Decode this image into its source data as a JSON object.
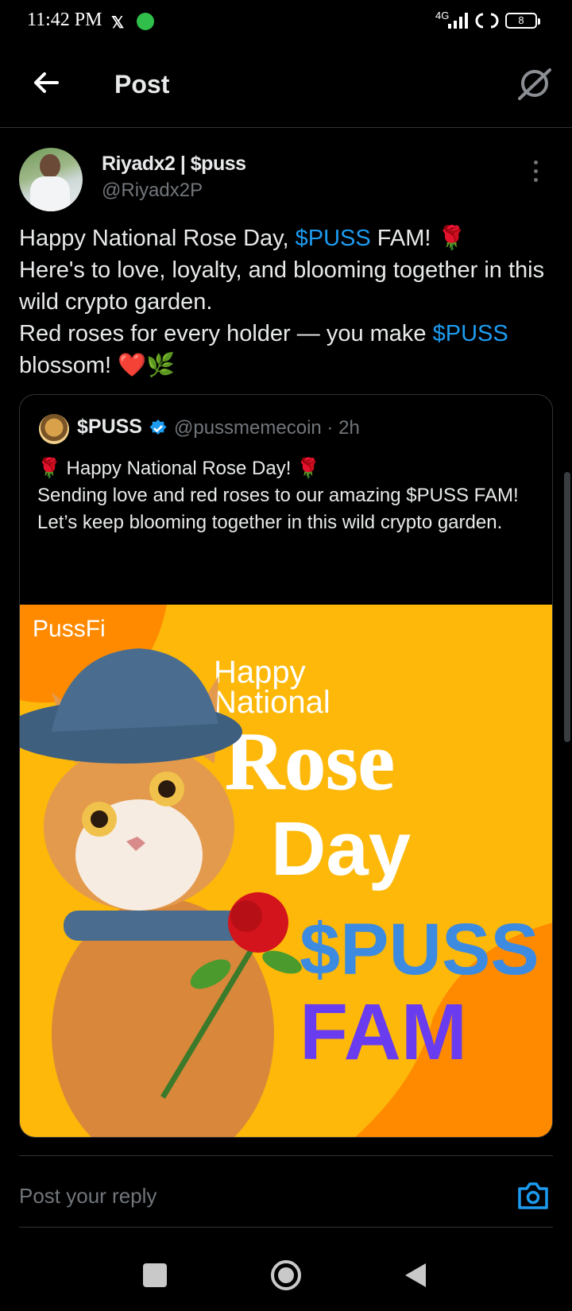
{
  "status_bar": {
    "time": "11:42 PM",
    "x_badge": "𝕏",
    "network": "4G",
    "battery": "8"
  },
  "header": {
    "title": "Post"
  },
  "post": {
    "display_name": "Riyadx2 | $puss",
    "handle": "@Riyadx2P",
    "line1_a": "Happy National Rose Day, ",
    "line1_cash": "$PUSS",
    "line1_b": " FAM! 🌹",
    "line2": "Here's to love, loyalty, and blooming together in this wild crypto garden.",
    "line3_a": "Red roses for every holder — you make ",
    "line3_cash": "$PUSS",
    "line3_b": " blossom! ❤️🌿"
  },
  "quoted_post": {
    "name": "$PUSS",
    "handle_time": "@pussmemecoin · 2h",
    "lines": [
      "🌹 Happy National Rose Day! 🌹",
      "Sending love and red roses to our amazing $PUSS FAM!",
      "Let’s keep blooming together in this wild crypto garden."
    ],
    "image": {
      "brand": "PussFi",
      "happy": "Happy",
      "national": "National",
      "rose": "Rose",
      "day": "Day",
      "puss": "$PUSS",
      "fam": "FAM"
    }
  },
  "reply": {
    "placeholder": "Post your reply"
  },
  "colors": {
    "accent": "#1d9bf0",
    "image_bg": "#fdb80a",
    "image_orange": "#ff8a00"
  },
  "icons": {
    "back": "arrow-left-icon",
    "grok": "grok-icon",
    "more": "more-vertical-icon",
    "verified": "verified-badge-icon",
    "camera": "camera-icon"
  }
}
